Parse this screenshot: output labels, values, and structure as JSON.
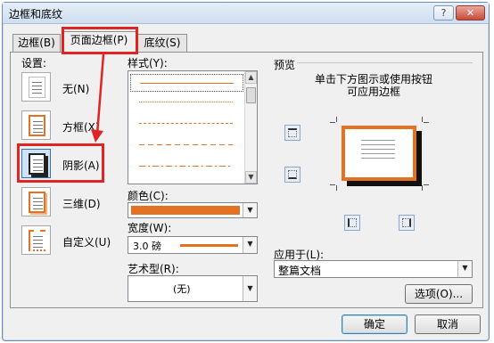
{
  "window": {
    "title": "边框和底纹",
    "help_glyph": "?",
    "close_glyph": "✕"
  },
  "tabs": [
    {
      "label": "边框(B)",
      "active": false
    },
    {
      "label": "页面边框(P)",
      "active": true
    },
    {
      "label": "底纹(S)",
      "active": false
    }
  ],
  "settings": {
    "title": "设置:",
    "items": [
      {
        "label": "无(N)",
        "icon": "none-border-icon",
        "selected": false
      },
      {
        "label": "方框(X)",
        "icon": "box-border-icon",
        "selected": false
      },
      {
        "label": "阴影(A)",
        "icon": "shadow-border-icon",
        "selected": true
      },
      {
        "label": "三维(D)",
        "icon": "3d-border-icon",
        "selected": false
      },
      {
        "label": "自定义(U)",
        "icon": "custom-border-icon",
        "selected": false
      }
    ]
  },
  "style": {
    "title": "样式(Y):",
    "selected_index": 0,
    "line_styles": [
      "solid",
      "dotted",
      "dashed-small",
      "dashed",
      "dash-dot",
      "dash-dot-dot"
    ],
    "line_color": "#e37222"
  },
  "color": {
    "title": "颜色(C):",
    "value_hex": "#e37222"
  },
  "width": {
    "title": "宽度(W):",
    "value": "3.0 磅"
  },
  "art": {
    "title": "艺术型(R):",
    "value": "(无)"
  },
  "preview": {
    "title": "预览",
    "hint": "单击下方图示或使用按钮可应用边框",
    "border_color": "#e37222",
    "buttons": [
      "top-border-icon",
      "bottom-border-icon",
      "left-border-icon",
      "right-border-icon"
    ]
  },
  "apply_to": {
    "title": "应用于(L):",
    "value": "整篇文档"
  },
  "buttons": {
    "options": "选项(O)...",
    "ok": "确定",
    "cancel": "取消"
  },
  "annotation_color": "#e02424"
}
